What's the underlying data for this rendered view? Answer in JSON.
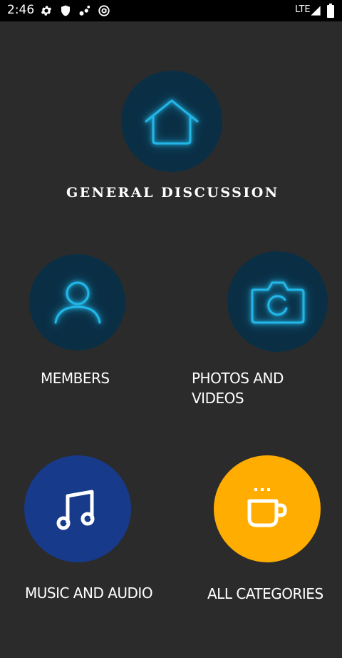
{
  "status_bar": {
    "time": "2:46",
    "network": "LTE"
  },
  "colors": {
    "background": "#2b2b2b",
    "dark_circle": "#0a2f45",
    "neon_icon": "#22b7e8",
    "music_circle": "#173a8a",
    "categories_circle": "#ffad00"
  },
  "categories": {
    "general_discussion": {
      "label": "GENERAL DISCUSSION",
      "icon": "home-icon"
    },
    "members": {
      "label": "MEMBERS",
      "icon": "person-icon"
    },
    "photos_videos": {
      "label": "PHOTOS AND\nVIDEOS",
      "icon": "camera-icon"
    },
    "music_audio": {
      "label": "MUSIC AND AUDIO",
      "icon": "music-note-icon"
    },
    "all_categories": {
      "label": "ALL CATEGORIES",
      "icon": "coffee-cup-icon"
    }
  }
}
